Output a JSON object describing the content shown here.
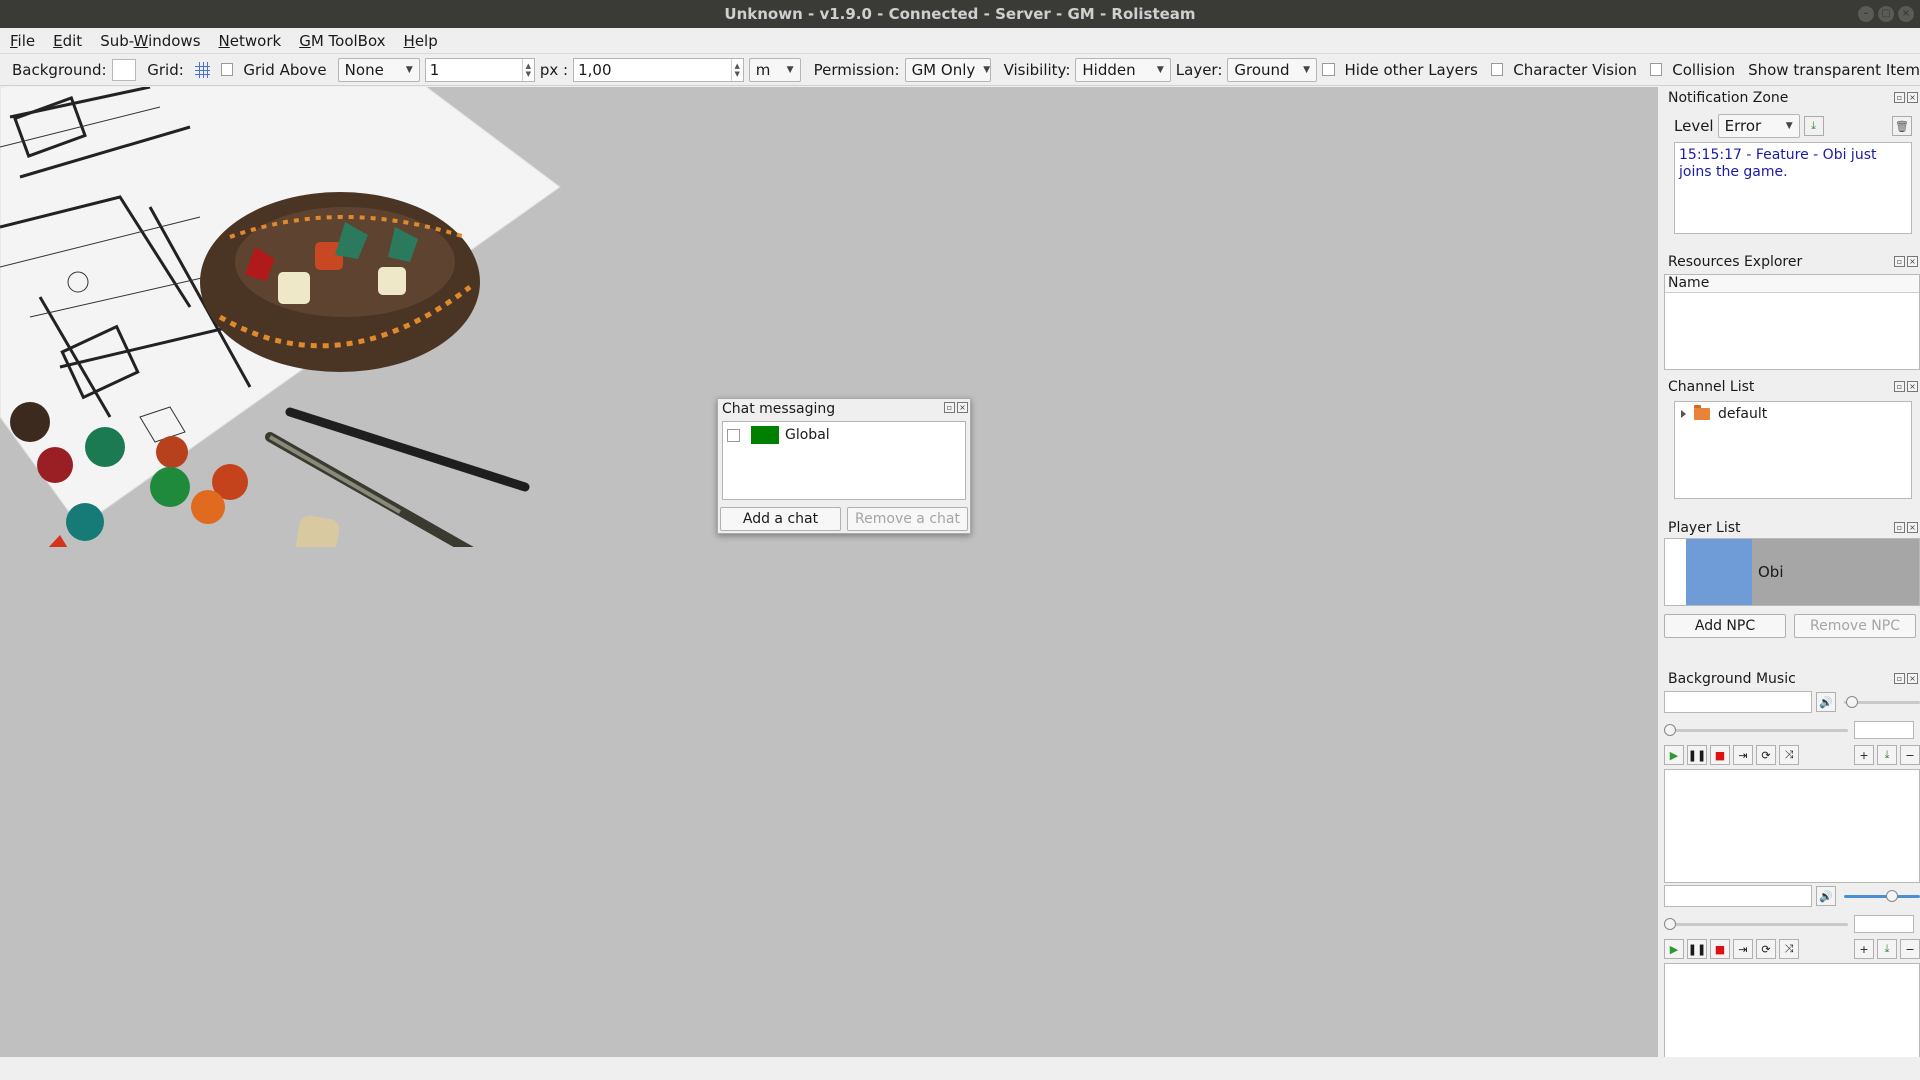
{
  "window": {
    "title": "Unknown - v1.9.0 - Connected - Server - GM - Rolisteam"
  },
  "menubar": {
    "items": [
      {
        "label": "File",
        "mnemonic_index": 0
      },
      {
        "label": "Edit",
        "mnemonic_index": 0
      },
      {
        "label": "Sub-Windows",
        "mnemonic_index": 4
      },
      {
        "label": "Network",
        "mnemonic_index": 0
      },
      {
        "label": "GM ToolBox",
        "mnemonic_index": 0
      },
      {
        "label": "Help",
        "mnemonic_index": 0
      }
    ]
  },
  "toolbar": {
    "background_label": "Background:",
    "grid_label": "Grid:",
    "grid_above_label": "Grid Above",
    "grid_shape_value": "None",
    "grid_size_value": "1",
    "px_label": "px :",
    "scale_value": "1,00",
    "unit_value": "m",
    "permission_label": "Permission:",
    "permission_value": "GM Only",
    "visibility_label": "Visibility:",
    "visibility_value": "Hidden",
    "layer_label": "Layer:",
    "layer_value": "Ground",
    "hide_other_layers_label": "Hide other Layers",
    "character_vision_label": "Character Vision",
    "collision_label": "Collision",
    "show_transparent_label": "Show transparent Item"
  },
  "chat_window": {
    "title": "Chat messaging",
    "chats": [
      {
        "name": "Global",
        "color": "#008000"
      }
    ],
    "add_label": "Add a chat",
    "remove_label": "Remove a chat"
  },
  "notification_zone": {
    "title": "Notification Zone",
    "level_label": "Level",
    "level_value": "Error",
    "message": "15:15:17 - Feature - Obi just joins the game."
  },
  "resources_explorer": {
    "title": "Resources Explorer",
    "column_header": "Name"
  },
  "channel_list": {
    "title": "Channel List",
    "channels": [
      {
        "name": "default"
      }
    ]
  },
  "player_list": {
    "title": "Player List",
    "players": [
      {
        "name": "Obi",
        "color": "#6f9bd6"
      }
    ],
    "add_npc_label": "Add NPC",
    "remove_npc_label": "Remove NPC"
  },
  "background_music": {
    "title": "Background Music"
  },
  "colors": {
    "canvas": "#c0c0c0",
    "notification_text": "#1a1aa8",
    "player_selected_bg": "#a6a6a6"
  }
}
